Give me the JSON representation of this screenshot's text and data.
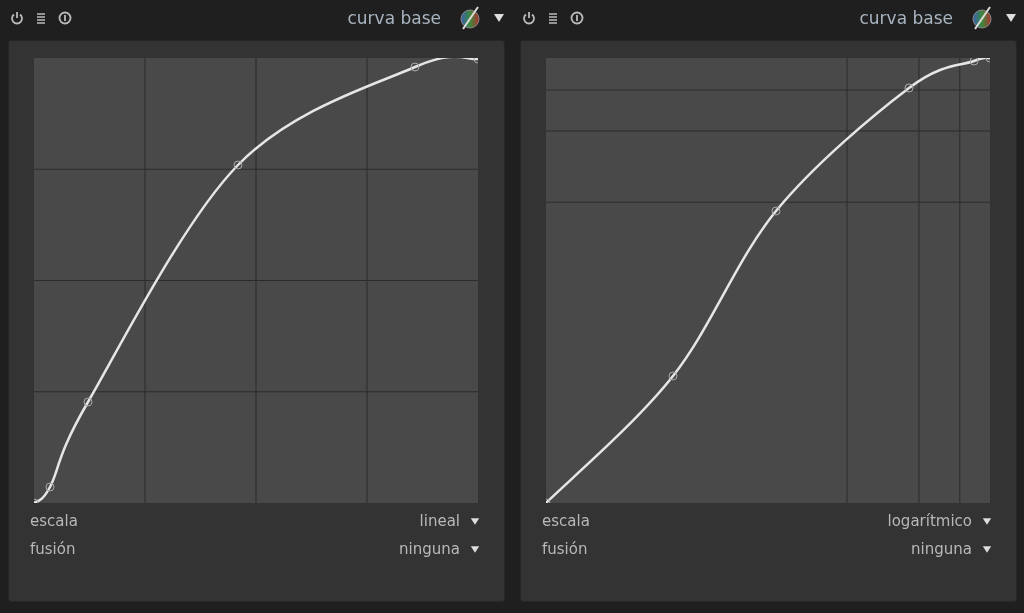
{
  "modules": [
    {
      "title": "curva base",
      "graph": {
        "kind": "linear"
      },
      "settings": [
        {
          "label": "escala",
          "value": "lineal"
        },
        {
          "label": "fusión",
          "value": "ninguna"
        }
      ]
    },
    {
      "title": "curva base",
      "graph": {
        "kind": "log"
      },
      "settings": [
        {
          "label": "escala",
          "value": "logarítmico"
        },
        {
          "label": "fusión",
          "value": "ninguna"
        }
      ]
    }
  ]
}
